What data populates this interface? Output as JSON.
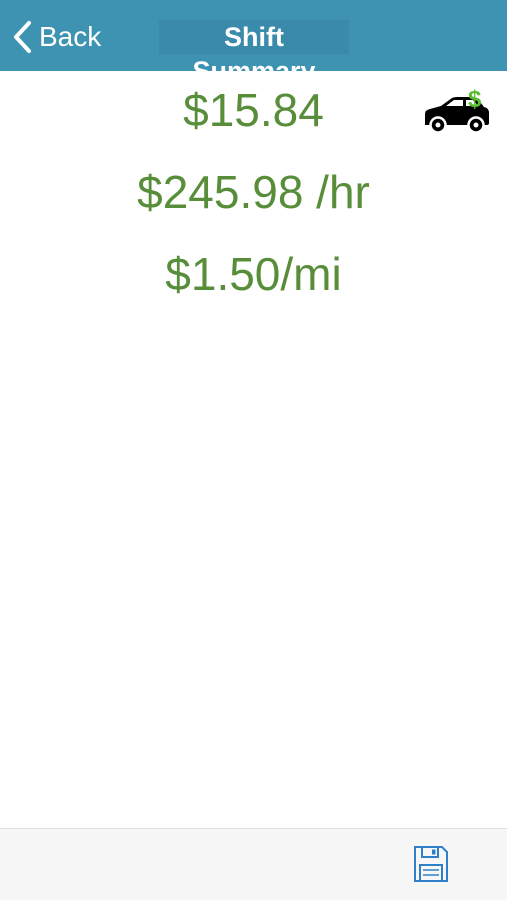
{
  "header": {
    "back_label": "Back",
    "title": "Shift Summary"
  },
  "summary": {
    "total": "$15.84",
    "hourly_rate": "$245.98 /hr",
    "per_mile": "$1.50/mi"
  },
  "icons": {
    "back": "chevron-left-icon",
    "car": "car-dollar-icon",
    "save": "floppy-disk-icon"
  },
  "colors": {
    "navbar": "#3f93b2",
    "title_highlight": "#3a8bab",
    "value_text": "#588d3a",
    "dollar_sign": "#5bbd2e",
    "save_icon": "#2f80c8",
    "toolbar": "#f7f7f7"
  }
}
